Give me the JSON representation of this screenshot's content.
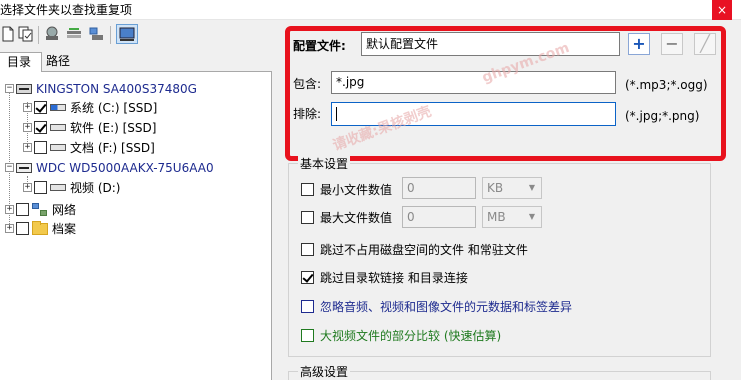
{
  "window": {
    "title": "选择文件夹以查找重复项",
    "close_glyph": "×"
  },
  "tabs": [
    {
      "label": "目录"
    },
    {
      "label": "路径"
    }
  ],
  "tree": {
    "disk1": {
      "label": "KINGSTON SA400S37480G",
      "expander": "−"
    },
    "c": {
      "label": "系统 (C:) [SSD]",
      "expander": "+"
    },
    "e": {
      "label": "软件 (E:) [SSD]",
      "expander": "+"
    },
    "f": {
      "label": "文档 (F:) [SSD]",
      "expander": "+"
    },
    "disk2": {
      "label": "WDC WD5000AAKX-75U6AA0",
      "expander": "−"
    },
    "d": {
      "label": "视频 (D:)",
      "expander": "+"
    },
    "net": {
      "label": "网络",
      "expander": "+"
    },
    "arch": {
      "label": "档案",
      "expander": "+"
    }
  },
  "profile": {
    "label": "配置文件:",
    "value": "默认配置文件",
    "add_glyph": "+",
    "remove_glyph": "−",
    "edit_glyph": "╱"
  },
  "include": {
    "label": "包含:",
    "value": "*.jpg",
    "hint": "(*.mp3;*.ogg)"
  },
  "exclude": {
    "label": "排除:",
    "value": "",
    "hint": "(*.jpg;*.png)"
  },
  "basic": {
    "title": "基本设置",
    "min_size": {
      "label": "最小文件数值",
      "value": "0",
      "unit": "KB"
    },
    "max_size": {
      "label": "最大文件数值",
      "value": "0",
      "unit": "MB"
    },
    "skip_unused": "跳过不占用磁盘空间的文件 和常驻文件",
    "skip_links": "跳过目录软链接 和目录连接",
    "ignore_meta": "忽略音频、视频和图像文件的元数据和标签差异",
    "partial_compare": "大视频文件的部分比较 (快速估算)"
  },
  "advanced": {
    "title": "高级设置"
  },
  "watermark": {
    "text1": "请收藏:果核剥壳",
    "text2": "ghpym.com"
  },
  "colors": {
    "highlight_border": "#e8121d",
    "add_button": "#1a56b8",
    "blue_text": "#1e2b8f",
    "green_text": "#1f7a1f"
  }
}
